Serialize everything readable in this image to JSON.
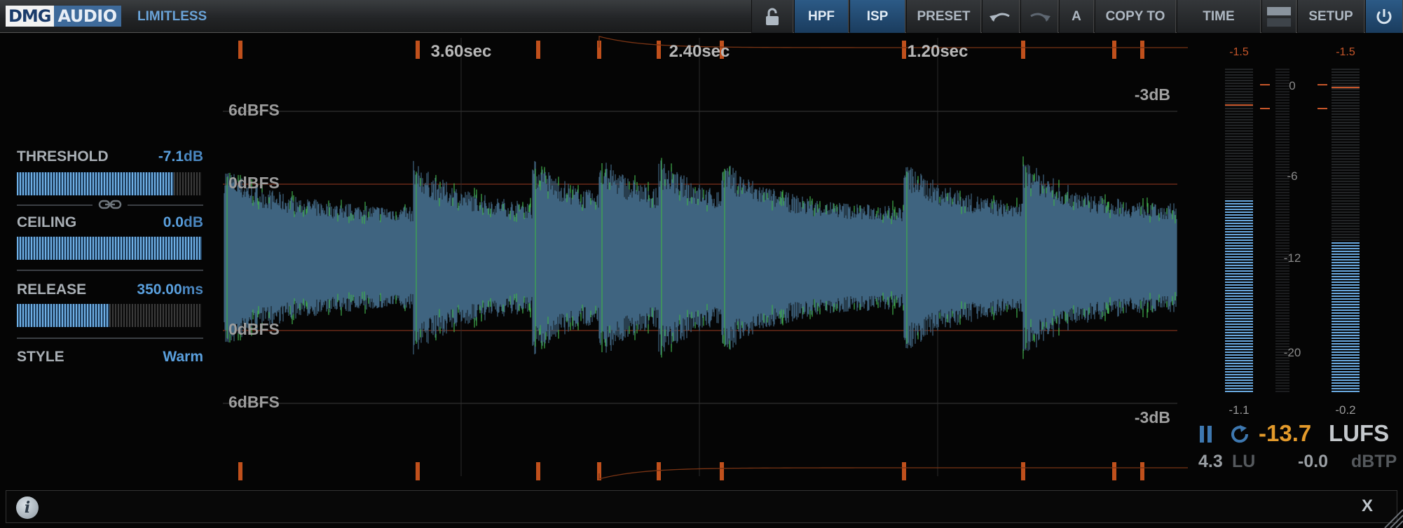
{
  "header": {
    "brand_left": "DMG",
    "brand_right": "AUDIO",
    "product": "LIMITLESS",
    "buttons": [
      {
        "id": "lock",
        "label": "",
        "icon": "unlock-icon",
        "active": false
      },
      {
        "id": "hpf",
        "label": "HPF",
        "active": true
      },
      {
        "id": "isp",
        "label": "ISP",
        "active": true
      },
      {
        "id": "preset",
        "label": "PRESET",
        "active": false
      },
      {
        "id": "undo",
        "label": "",
        "icon": "undo-icon",
        "active": false
      },
      {
        "id": "redo",
        "label": "",
        "icon": "redo-icon",
        "active": false
      },
      {
        "id": "ab",
        "label": "A",
        "active": false
      },
      {
        "id": "copy",
        "label": "COPY TO",
        "active": false
      },
      {
        "id": "time",
        "label": "TIME",
        "active": false
      },
      {
        "id": "view",
        "label": "",
        "icon": "view-toggle-icon",
        "active": false
      },
      {
        "id": "setup",
        "label": "SETUP",
        "active": false
      },
      {
        "id": "power",
        "label": "",
        "icon": "power-icon",
        "active": true
      }
    ]
  },
  "params": {
    "threshold": {
      "label": "THRESHOLD",
      "value": "-7.1",
      "unit": "dB",
      "level": 0.85
    },
    "ceiling": {
      "label": "CEILING",
      "value": "0.0",
      "unit": "dB",
      "level": 1.0
    },
    "release": {
      "label": "RELEASE",
      "value": "350.00",
      "unit": "ms",
      "level": 0.5
    },
    "style": {
      "label": "STYLE",
      "value": "Warm"
    }
  },
  "waveform": {
    "time_labels": [
      "3.60sec",
      "2.40sec",
      "1.20sec"
    ],
    "level_labels": [
      "6dBFS",
      "0dBFS",
      "0dBFS",
      "6dBFS"
    ],
    "gr_labels": [
      "-3dB",
      "-3dB"
    ]
  },
  "meters": {
    "peak_left": "-1.5",
    "peak_right": "-1.5",
    "scale": [
      "0",
      "-6",
      "-12",
      "-20"
    ],
    "value_left": "-1.1",
    "value_right": "-0.2",
    "level_left": 0.6,
    "level_right": 0.47
  },
  "loudness": {
    "value": "-13.7",
    "unit": "LUFS",
    "range": "4.3",
    "range_unit": "LU",
    "true_peak": "-0.0",
    "true_peak_unit": "dBTP"
  },
  "info": {
    "close_label": "X"
  },
  "colors": {
    "accent": "#5aa0de",
    "wave": "#3f6480",
    "wave_peak": "#3fae4a",
    "gain_reduction": "#c0501c",
    "lufs": "#e39a2b"
  }
}
